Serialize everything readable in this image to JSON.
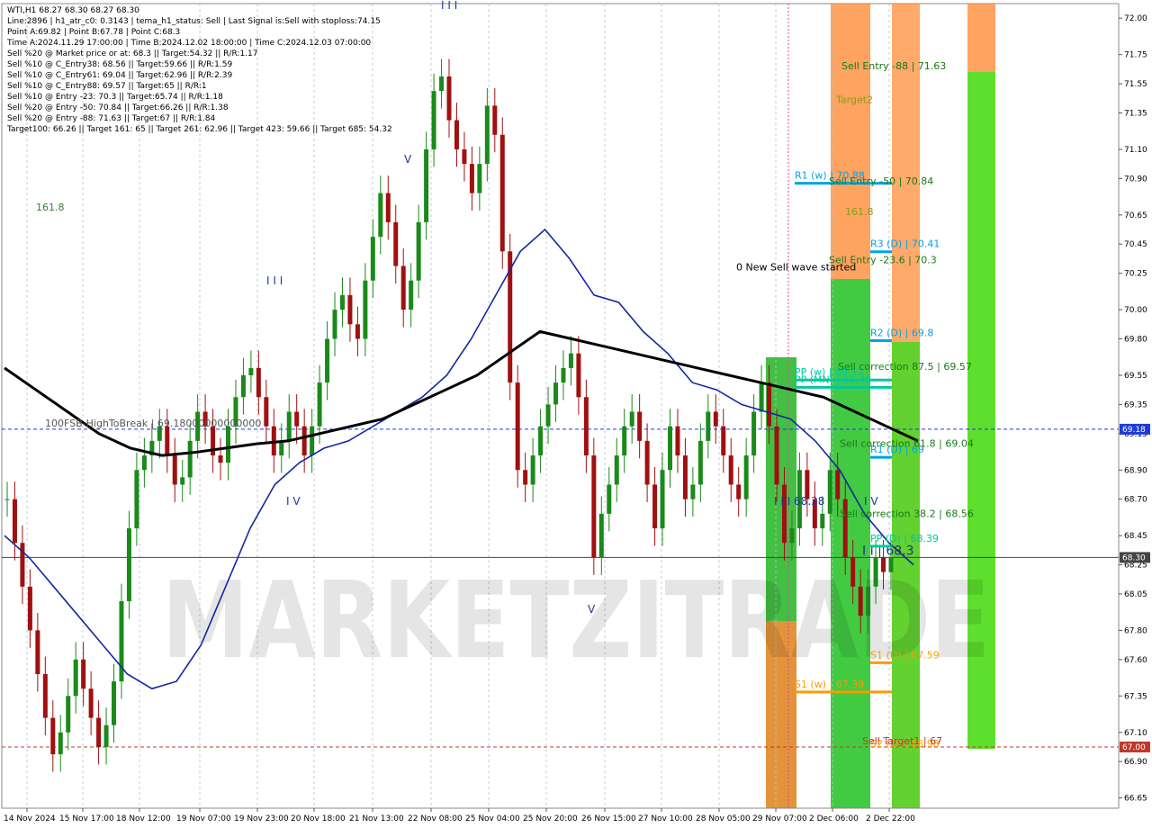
{
  "header": {
    "info_lines": [
      "WTI,H1  68.27 68.30 68.27 68.30",
      "Line:2896 | h1_atr_c0: 0.3143 | tema_h1_status: Sell | Last Signal is:Sell with stoploss:74.15",
      "Point A:69.82 | Point B:67.78 | Point C:68.3",
      "Time A:2024.11.29 17:00:00 | Time B:2024.12.02 18:00:00 | Time C:2024.12.03 07:00:00",
      "Sell %20 @ Market price or at: 68.3 || Target:54.32 || R/R:1.17",
      "Sell %10 @ C_Entry38: 68.56 || Target:59.66 || R/R:1.59",
      "Sell %10 @ C_Entry61: 69.04 || Target:62.96 || R/R:2.39",
      "Sell %10 @ C_Entry88: 69.57 || Target:65 || R/R:1",
      "Sell %10 @ Entry -23: 70.3 || Target:65.74 || R/R:1.18",
      "Sell %20 @ Entry -50: 70.84 || Target:66.26 || R/R:1.38",
      "Sell %20 @ Entry -88: 71.63 || Target:67 || R/R:1.84",
      "Target100: 66.26 || Target 161: 65 || Target 261: 62.96 || Target 423: 59.66 || Target 685: 54.32"
    ]
  },
  "watermark": "MARKETZITRADE",
  "chart_data": {
    "type": "candlestick",
    "symbol": "WTI,H1",
    "ylim": [
      66.58,
      72.1
    ],
    "y_ticks": [
      "72.00",
      "71.75",
      "71.55",
      "71.35",
      "71.10",
      "70.90",
      "70.65",
      "70.45",
      "70.25",
      "70.00",
      "69.80",
      "69.55",
      "69.35",
      "69.15",
      "68.90",
      "68.70",
      "68.45",
      "68.25",
      "68.05",
      "67.80",
      "67.60",
      "67.35",
      "67.10",
      "66.90",
      "66.65"
    ],
    "x_ticks": [
      "14 Nov 2024",
      "15 Nov 17:00",
      "18 Nov 12:00",
      "19 Nov 07:00",
      "19 Nov 23:00",
      "20 Nov 18:00",
      "21 Nov 13:00",
      "22 Nov 08:00",
      "25 Nov 04:00",
      "25 Nov 20:00",
      "26 Nov 15:00",
      "27 Nov 10:00",
      "28 Nov 05:00",
      "29 Nov 07:00",
      "2 Dec 06:00",
      "2 Dec 22:00"
    ],
    "price_tags": [
      {
        "value": 69.18,
        "text": "69.18",
        "color": "#1e3bd8"
      },
      {
        "value": 68.3,
        "text": "68.30",
        "color": "#444444"
      },
      {
        "value": 67.0,
        "text": "67.00",
        "color": "#c0392b"
      }
    ],
    "closes": [
      68.7,
      68.4,
      68.1,
      67.8,
      67.5,
      67.2,
      66.95,
      67.1,
      67.35,
      67.6,
      67.4,
      67.2,
      67.0,
      67.15,
      67.45,
      68.0,
      68.5,
      68.9,
      69.0,
      69.1,
      69.2,
      69.0,
      68.8,
      68.85,
      69.1,
      69.3,
      69.2,
      69.0,
      68.95,
      69.2,
      69.4,
      69.55,
      69.6,
      69.4,
      69.2,
      69.0,
      69.1,
      69.3,
      69.2,
      69.0,
      69.2,
      69.5,
      69.8,
      70.0,
      70.1,
      69.9,
      69.8,
      70.2,
      70.5,
      70.8,
      70.6,
      70.3,
      70.0,
      70.2,
      70.6,
      71.1,
      71.5,
      71.6,
      71.3,
      71.1,
      71.0,
      70.8,
      71.0,
      71.4,
      71.2,
      70.4,
      69.5,
      68.9,
      68.8,
      69.0,
      69.2,
      69.35,
      69.5,
      69.6,
      69.7,
      69.4,
      69.0,
      68.3,
      68.6,
      68.8,
      69.0,
      69.2,
      69.3,
      69.1,
      68.8,
      68.5,
      68.9,
      69.2,
      69.0,
      68.7,
      68.8,
      69.1,
      69.3,
      69.2,
      69.0,
      68.8,
      68.7,
      69.0,
      69.3,
      69.5,
      69.2,
      68.8,
      68.4,
      68.5,
      68.9,
      68.7,
      68.5,
      68.6,
      68.9,
      68.7,
      68.3,
      68.1,
      67.9,
      68.1,
      68.3,
      68.2,
      68.3
    ],
    "series": [
      {
        "name": "",
        "color": "#1428a0",
        "values": [
          68.45,
          68.3,
          68.1,
          67.9,
          67.7,
          67.5,
          67.4,
          67.45,
          67.7,
          68.1,
          68.5,
          68.8,
          68.95,
          69.05,
          69.1,
          69.2,
          69.3,
          69.4,
          69.55,
          69.8,
          70.1,
          70.4,
          70.55,
          70.35,
          70.1,
          70.05,
          69.85,
          69.7,
          69.5,
          69.45,
          69.35,
          69.3,
          69.25,
          69.1,
          68.9,
          68.6,
          68.4,
          68.25
        ]
      },
      {
        "name": "",
        "color": "#000000",
        "values": [
          69.6,
          69.45,
          69.3,
          69.15,
          69.05,
          69.0,
          69.02,
          69.05,
          69.08,
          69.1,
          69.15,
          69.2,
          69.25,
          69.35,
          69.45,
          69.55,
          69.7,
          69.85,
          69.8,
          69.75,
          69.7,
          69.65,
          69.6,
          69.55,
          69.5,
          69.45,
          69.4,
          69.3,
          69.2,
          69.1
        ]
      }
    ],
    "levels": [
      {
        "label": "Sell Entry -88 | 71.63",
        "value": 71.63,
        "color": "#1a7a1a"
      },
      {
        "label": "Target2",
        "value": 71.4,
        "color": "#8a9a1a"
      },
      {
        "label": "R1 (w) | 70.88",
        "value": 70.88,
        "color": "#00a2e8"
      },
      {
        "label": "Sell Entry -50 | 70.84",
        "value": 70.84,
        "color": "#1a7a1a"
      },
      {
        "label": "161.8",
        "value": 70.63,
        "color": "#8a9a1a"
      },
      {
        "label": "R3 (D) | 70.41",
        "value": 70.41,
        "color": "#00a2e8"
      },
      {
        "label": "Sell Entry -23.6 | 70.3",
        "value": 70.3,
        "color": "#1a7a1a"
      },
      {
        "label": "0 New Sell wave started",
        "value": 70.25,
        "color": "#000000"
      },
      {
        "label": "R2 (D) | 69.8",
        "value": 69.8,
        "color": "#00a2e8"
      },
      {
        "label": "PP (w) | 69.53",
        "value": 69.53,
        "color": "#00c8a0"
      },
      {
        "label": "PP (MN) | 69.48",
        "value": 69.48,
        "color": "#00c8a0"
      },
      {
        "label": "Sell correction 87.5 | 69.57",
        "value": 69.57,
        "color": "#1a7a1a"
      },
      {
        "label": "100FSB-HighToBreak | 69.18000000000000",
        "value": 69.18,
        "color": "#555555"
      },
      {
        "label": "R1 (D) | 69",
        "value": 69.0,
        "color": "#00a2e8"
      },
      {
        "label": "Sell correction 61.8 | 69.04",
        "value": 69.04,
        "color": "#1a7a1a"
      },
      {
        "label": "I I | 68.3",
        "value": 68.3,
        "color": "#1a3a7a"
      },
      {
        "label": "Sell correction 38.2 | 68.56",
        "value": 68.56,
        "color": "#1a7a1a"
      },
      {
        "label": "PP (D) | 68.39",
        "value": 68.39,
        "color": "#00c8a0"
      },
      {
        "label": "S1 (D) | 67.59",
        "value": 67.59,
        "color": "#ff9900"
      },
      {
        "label": "S1 (w) | 67.39",
        "value": 67.39,
        "color": "#ff9900"
      },
      {
        "label": "S2 (D) | 66.98",
        "value": 66.98,
        "color": "#ff9900"
      },
      {
        "label": "Sell Target1 | 67",
        "value": 67.0,
        "color": "#c0392b"
      }
    ],
    "annotations": [
      "161.8",
      "I I I",
      "I V",
      "V",
      "I I I",
      "V",
      "I V",
      "I I I 68.38",
      "I V"
    ]
  }
}
